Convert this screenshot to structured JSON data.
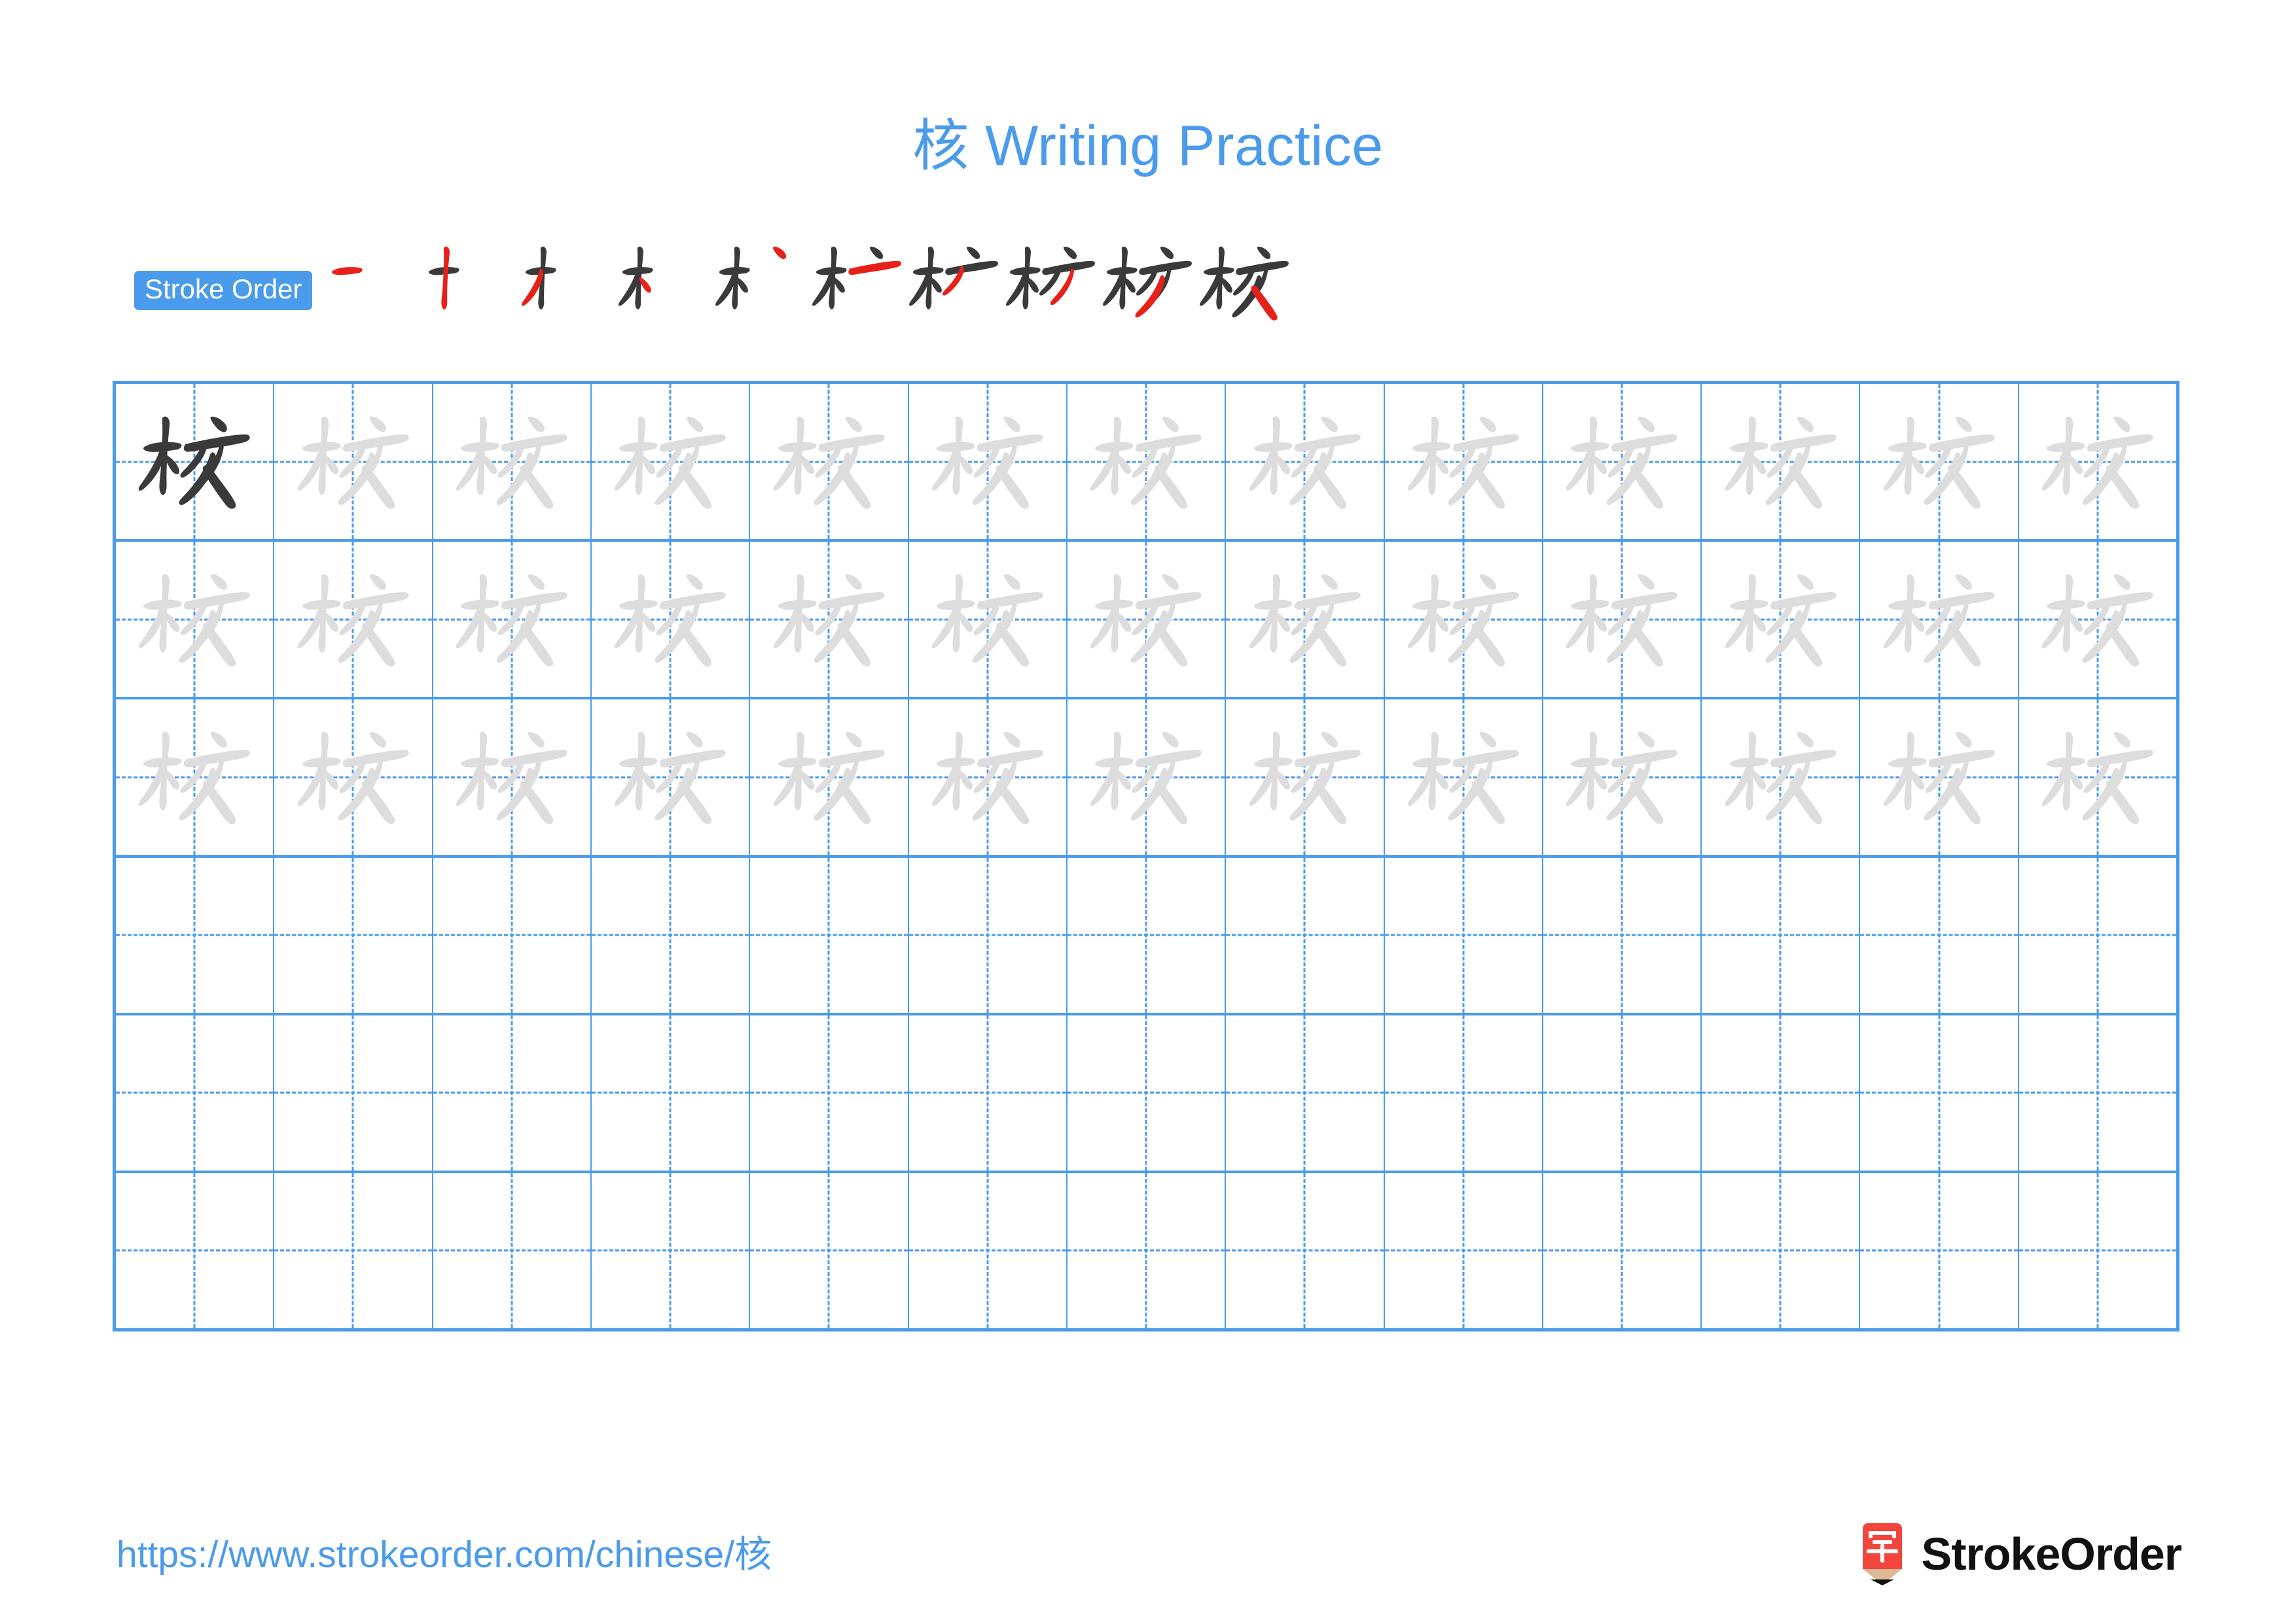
{
  "page": {
    "title": "核 Writing Practice",
    "character": "核",
    "theme_color": "#4a9beb",
    "trace_color": "#dddddd",
    "solid_color": "#3a3a3a",
    "new_stroke_color": "#e8201a",
    "background": "#ffffff"
  },
  "stroke_order": {
    "badge_label": "Stroke Order",
    "total_strokes": 10,
    "steps": [
      {
        "index": 1,
        "stroke_count": 1,
        "label": "一"
      },
      {
        "index": 2,
        "stroke_count": 2,
        "label": "十"
      },
      {
        "index": 3,
        "stroke_count": 3,
        "label": "扌"
      },
      {
        "index": 4,
        "stroke_count": 4,
        "label": "木"
      },
      {
        "index": 5,
        "stroke_count": 5,
        "label": "朮"
      },
      {
        "index": 6,
        "stroke_count": 6,
        "label": "杧"
      },
      {
        "index": 7,
        "stroke_count": 7,
        "label": "杧"
      },
      {
        "index": 8,
        "stroke_count": 8,
        "label": "杉"
      },
      {
        "index": 9,
        "stroke_count": 9,
        "label": "核"
      },
      {
        "index": 10,
        "stroke_count": 10,
        "label": "核"
      }
    ]
  },
  "practice_grid": {
    "columns": 13,
    "rows": 6,
    "row_fill": [
      {
        "row": 1,
        "cells": [
          "solid",
          "trace",
          "trace",
          "trace",
          "trace",
          "trace",
          "trace",
          "trace",
          "trace",
          "trace",
          "trace",
          "trace",
          "trace"
        ]
      },
      {
        "row": 2,
        "cells": [
          "trace",
          "trace",
          "trace",
          "trace",
          "trace",
          "trace",
          "trace",
          "trace",
          "trace",
          "trace",
          "trace",
          "trace",
          "trace"
        ]
      },
      {
        "row": 3,
        "cells": [
          "trace",
          "trace",
          "trace",
          "trace",
          "trace",
          "trace",
          "trace",
          "trace",
          "trace",
          "trace",
          "trace",
          "trace",
          "trace"
        ]
      },
      {
        "row": 4,
        "cells": [
          "empty",
          "empty",
          "empty",
          "empty",
          "empty",
          "empty",
          "empty",
          "empty",
          "empty",
          "empty",
          "empty",
          "empty",
          "empty"
        ]
      },
      {
        "row": 5,
        "cells": [
          "empty",
          "empty",
          "empty",
          "empty",
          "empty",
          "empty",
          "empty",
          "empty",
          "empty",
          "empty",
          "empty",
          "empty",
          "empty"
        ]
      },
      {
        "row": 6,
        "cells": [
          "empty",
          "empty",
          "empty",
          "empty",
          "empty",
          "empty",
          "empty",
          "empty",
          "empty",
          "empty",
          "empty",
          "empty",
          "empty"
        ]
      }
    ]
  },
  "footer": {
    "url": "https://www.strokeorder.com/chinese/核",
    "brand_name": "StrokeOrder",
    "brand_icon_char": "字",
    "brand_icon_color": "#f2453d",
    "brand_icon_tip_color": "#ddb894"
  }
}
